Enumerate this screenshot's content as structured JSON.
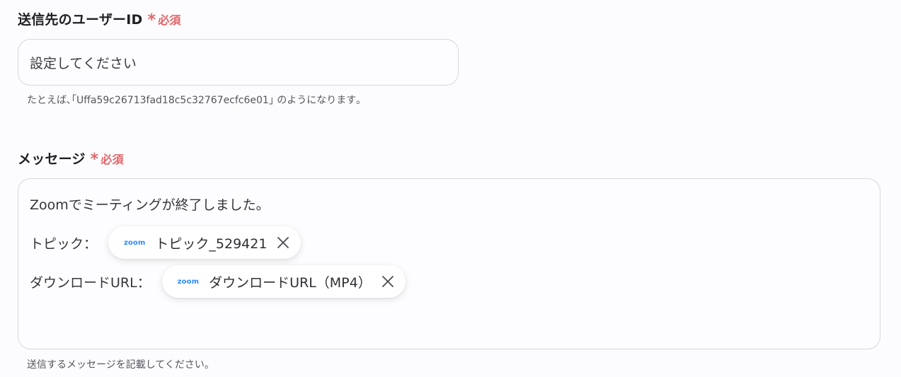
{
  "recipient_field": {
    "label": "送信先のユーザーID",
    "required_mark": "*",
    "required_text": "必須",
    "placeholder": "設定してください",
    "hint": "たとえば､｢Uffa59c26713fad18c5c32767ecfc6e01｣ のようになります｡"
  },
  "message_field": {
    "label": "メッセージ",
    "required_mark": "*",
    "required_text": "必須",
    "line1": "Zoomでミーティングが終了しました。",
    "topic_prefix": "トピック：",
    "topic_chip": {
      "source": "zoom",
      "label": "トピック_529421"
    },
    "url_prefix": "ダウンロードURL：",
    "url_chip": {
      "source": "zoom",
      "label": "ダウンロードURL（MP4）"
    },
    "hint": "送信するメッセージを記載してください。"
  },
  "colors": {
    "required": "#e2666a",
    "zoom_brand": "#2d8cff",
    "border": "#d7d6db"
  },
  "icons": {
    "required": "asterisk-icon",
    "chip_remove": "close-icon",
    "chip_source": "zoom-logo-icon"
  }
}
